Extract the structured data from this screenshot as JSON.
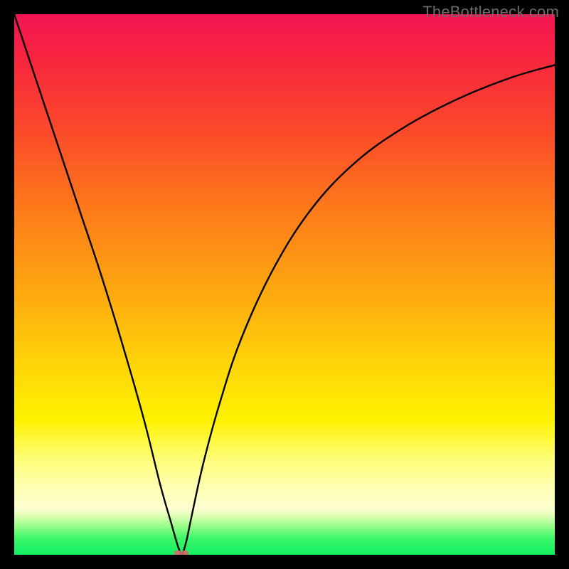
{
  "watermark": "TheBottleneck.com",
  "chart_data": {
    "type": "line",
    "title": "",
    "xlabel": "",
    "ylabel": "",
    "xlim": [
      0,
      100
    ],
    "ylim": [
      0,
      100
    ],
    "grid": false,
    "legend": false,
    "annotations": [],
    "cusp_x": 31,
    "series": [
      {
        "name": "bottleneck-curve",
        "x": [
          0,
          4,
          8,
          12,
          16,
          20,
          24,
          27,
          29,
          30,
          30.6,
          31,
          31.4,
          32,
          33,
          35,
          38,
          42,
          48,
          55,
          63,
          72,
          82,
          92,
          100
        ],
        "y": [
          100,
          88,
          76,
          64,
          52,
          39,
          25,
          13,
          6,
          2.5,
          0.7,
          0,
          0.9,
          3.2,
          8,
          17,
          28,
          40,
          53,
          64,
          72.5,
          79,
          84.3,
          88.3,
          90.6
        ]
      }
    ],
    "background_gradient": {
      "stops": [
        {
          "pos": 0.0,
          "color": "#f41453"
        },
        {
          "pos": 0.08,
          "color": "#f7253e"
        },
        {
          "pos": 0.22,
          "color": "#fb4b2a"
        },
        {
          "pos": 0.36,
          "color": "#fd7a1a"
        },
        {
          "pos": 0.52,
          "color": "#feaa0f"
        },
        {
          "pos": 0.65,
          "color": "#fed508"
        },
        {
          "pos": 0.75,
          "color": "#fff200"
        },
        {
          "pos": 0.82,
          "color": "#fffd74"
        },
        {
          "pos": 0.87,
          "color": "#ffffac"
        },
        {
          "pos": 0.915,
          "color": "#feffd2"
        },
        {
          "pos": 0.93,
          "color": "#d8ffb0"
        },
        {
          "pos": 0.95,
          "color": "#8bfd84"
        },
        {
          "pos": 0.97,
          "color": "#3cf769"
        },
        {
          "pos": 1.0,
          "color": "#11ef62"
        }
      ]
    },
    "cusp_markers": [
      {
        "x": 30.3,
        "y": 0
      },
      {
        "x": 31.6,
        "y": 0
      }
    ]
  }
}
